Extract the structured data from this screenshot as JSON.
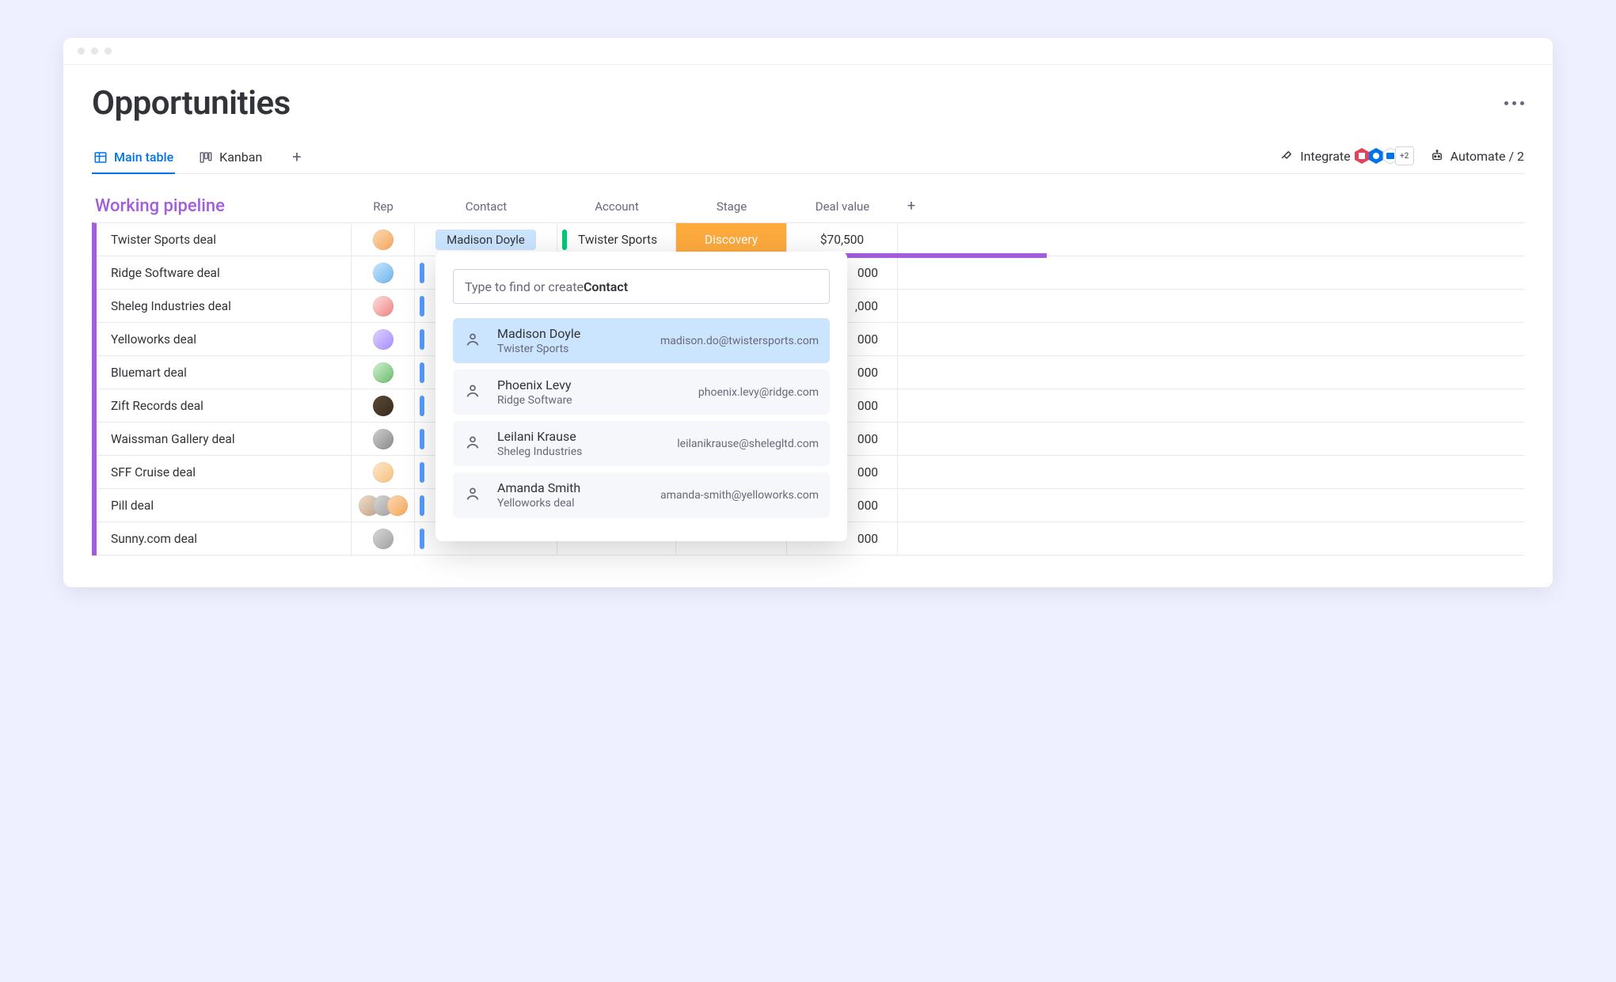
{
  "page_title": "Opportunities",
  "tabs": {
    "main": "Main table",
    "kanban": "Kanban"
  },
  "toolbar": {
    "integrate": "Integrate",
    "integrate_more": "+2",
    "automate": "Automate / 2"
  },
  "group": {
    "name": "Working pipeline",
    "columns": {
      "rep": "Rep",
      "contact": "Contact",
      "account": "Account",
      "stage": "Stage",
      "deal": "Deal value"
    }
  },
  "rows": [
    {
      "name": "Twister Sports deal",
      "contact": "Madison Doyle",
      "contact_full": true,
      "account_bar": "#00c875",
      "account": "Twister Sports",
      "stage": "Discovery",
      "stage_color": "#fdab3d",
      "deal": "$70,500"
    },
    {
      "name": "Ridge Software deal",
      "contact_bar": "#579bfc",
      "account_bar": "#00c875",
      "deal_suffix": "000"
    },
    {
      "name": "Sheleg Industries deal",
      "contact_bar": "#579bfc",
      "deal_suffix": ",000"
    },
    {
      "name": "Yelloworks deal",
      "contact_bar": "#579bfc",
      "deal_suffix": "000"
    },
    {
      "name": "Bluemart deal",
      "contact_bar": "#579bfc",
      "deal_suffix": "000"
    },
    {
      "name": "Zift Records deal",
      "contact_bar": "#579bfc",
      "deal_suffix": "000"
    },
    {
      "name": "Waissman Gallery deal",
      "contact_bar": "#579bfc",
      "deal_suffix": "000"
    },
    {
      "name": "SFF Cruise deal",
      "contact_bar": "#579bfc",
      "deal_suffix": "000"
    },
    {
      "name": "Pill deal",
      "contact_bar": "#579bfc",
      "deal_suffix": "000",
      "multi_avatar": true
    },
    {
      "name": "Sunny.com deal",
      "contact_bar": "#579bfc",
      "deal_suffix": "000"
    }
  ],
  "popover": {
    "placeholder_prefix": "Type to find or create ",
    "placeholder_bold": "Contact",
    "options": [
      {
        "name": "Madison Doyle",
        "org": "Twister Sports",
        "email": "madison.do@twistersports.com",
        "selected": true
      },
      {
        "name": "Phoenix Levy",
        "org": "Ridge Software",
        "email": "phoenix.levy@ridge.com"
      },
      {
        "name": "Leilani Krause",
        "org": "Sheleg Industries",
        "email": "leilanikrause@shelegltd.com"
      },
      {
        "name": "Amanda Smith",
        "org": "Yelloworks deal",
        "email": "amanda-smith@yelloworks.com"
      }
    ]
  },
  "avatar_gradients": [
    "linear-gradient(135deg,#ffd9b3,#f2a65a)",
    "linear-gradient(135deg,#c9e7ff,#6cb2eb)",
    "linear-gradient(135deg,#ffe0e0,#f08080)",
    "linear-gradient(135deg,#e0d4ff,#a58cff)",
    "linear-gradient(135deg,#d4f0d4,#66bb6a)",
    "linear-gradient(135deg,#5a4a3a,#3a2a1a)",
    "linear-gradient(135deg,#d0d0d0,#888888)",
    "linear-gradient(135deg,#ffe8cc,#f5c07a)",
    "linear-gradient(135deg,#f0e0d0,#c0a080)",
    "linear-gradient(135deg,#d8d8d8,#a0a0a0)"
  ]
}
